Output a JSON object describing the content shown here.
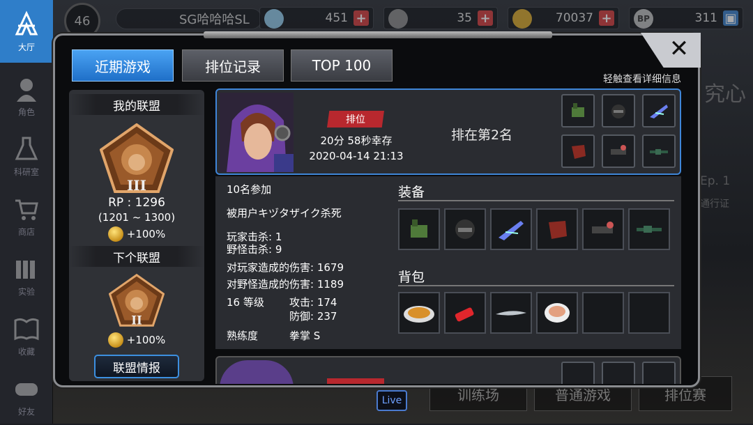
{
  "topbar": {
    "level": "46",
    "player_name": "SG哈哈哈SL",
    "diamonds": "451",
    "tickets": "35",
    "coins": "70037",
    "bp": "311",
    "bp_label": "BP"
  },
  "nav": {
    "items": [
      {
        "label": "大厅",
        "icon": "lobby-icon"
      },
      {
        "label": "角色",
        "icon": "character-icon"
      },
      {
        "label": "科研室",
        "icon": "lab-icon"
      },
      {
        "label": "商店",
        "icon": "cart-icon"
      },
      {
        "label": "实验",
        "icon": "books-icon"
      },
      {
        "label": "收藏",
        "icon": "book-icon"
      },
      {
        "label": "好友",
        "icon": "gamepad-icon"
      }
    ]
  },
  "background": {
    "right_text_1": "究心",
    "right_text_2": "Ep. 1",
    "right_text_3": "通行证",
    "live": "Live",
    "bottom_buttons": [
      "训练场",
      "普通游戏",
      "排位赛"
    ]
  },
  "modal": {
    "tabs": [
      "近期游戏",
      "排位记录",
      "TOP 100"
    ],
    "active_tab": 0,
    "hint": "轻触查看详细信息",
    "close": "✕"
  },
  "league": {
    "my_league_title": "我的联盟",
    "current_tier": "III",
    "rp": "RP : 1296",
    "rp_range": "(1201 ~ 1300)",
    "bonus": "+100%",
    "next_league_title": "下个联盟",
    "next_tier": "II",
    "next_bonus": "+100%",
    "info_button": "联盟情报"
  },
  "match": {
    "mode_badge": "排位",
    "survival_time": "20分 58秒幸存",
    "datetime": "2020-04-14 21:13",
    "placement": "排在第2名",
    "participants": "10名参加",
    "killed_by": "被用户キヅタザイク杀死",
    "player_kills": "玩家击杀: 1",
    "monster_kills": "野怪击杀: 9",
    "damage_to_players": "对玩家造成的伤害: 1679",
    "damage_to_monsters": "对野怪造成的伤害: 1189",
    "level": "16 等级",
    "attack": "攻击: 174",
    "defense": "防御: 237",
    "proficiency_label": "熟练度",
    "proficiency_value": "拳掌 S",
    "equipment_title": "装备",
    "backpack_title": "背包",
    "equipment": [
      "gauntlet-icon",
      "helmet-icon",
      "blade-icon",
      "armor-icon",
      "accessory-icon",
      "rifle-icon"
    ],
    "backpack": [
      "soup-icon",
      "lighter-icon",
      "fish-icon",
      "noodle-bowl-icon",
      "",
      ""
    ]
  },
  "colors": {
    "accent": "#2f7ec9",
    "rank_badge": "#b8282e",
    "panel": "#2a2c31"
  }
}
